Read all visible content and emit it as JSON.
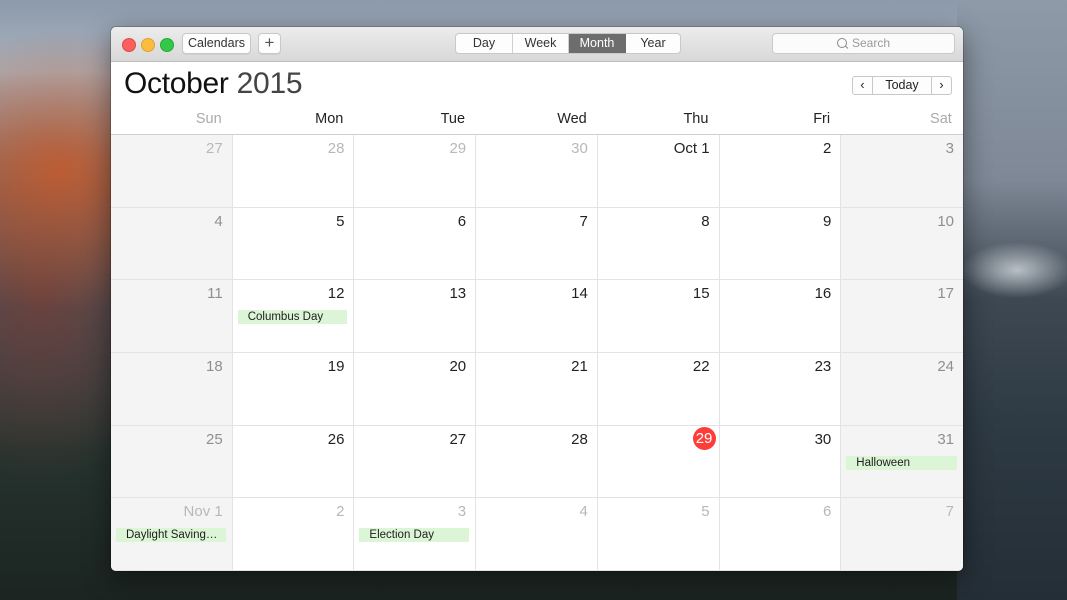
{
  "window": {
    "toolbar": {
      "calendars_label": "Calendars",
      "add_label": "+",
      "views": [
        {
          "label": "Day",
          "active": false
        },
        {
          "label": "Week",
          "active": false
        },
        {
          "label": "Month",
          "active": true
        },
        {
          "label": "Year",
          "active": false
        }
      ],
      "search_placeholder": "Search"
    },
    "header": {
      "month": "October",
      "year": "2015",
      "prev_label": "‹",
      "today_label": "Today",
      "next_label": "›"
    },
    "weekdays": [
      "Sun",
      "Mon",
      "Tue",
      "Wed",
      "Thu",
      "Fri",
      "Sat"
    ],
    "weeks": [
      [
        {
          "label": "27",
          "other": true
        },
        {
          "label": "28",
          "other": true
        },
        {
          "label": "29",
          "other": true
        },
        {
          "label": "30",
          "other": true
        },
        {
          "label": "Oct 1"
        },
        {
          "label": "2"
        },
        {
          "label": "3"
        }
      ],
      [
        {
          "label": "4"
        },
        {
          "label": "5"
        },
        {
          "label": "6"
        },
        {
          "label": "7"
        },
        {
          "label": "8"
        },
        {
          "label": "9"
        },
        {
          "label": "10"
        }
      ],
      [
        {
          "label": "11"
        },
        {
          "label": "12",
          "event": "Columbus Day"
        },
        {
          "label": "13"
        },
        {
          "label": "14"
        },
        {
          "label": "15"
        },
        {
          "label": "16"
        },
        {
          "label": "17"
        }
      ],
      [
        {
          "label": "18"
        },
        {
          "label": "19"
        },
        {
          "label": "20"
        },
        {
          "label": "21"
        },
        {
          "label": "22"
        },
        {
          "label": "23"
        },
        {
          "label": "24"
        }
      ],
      [
        {
          "label": "25"
        },
        {
          "label": "26"
        },
        {
          "label": "27"
        },
        {
          "label": "28"
        },
        {
          "label": "29",
          "today": true
        },
        {
          "label": "30"
        },
        {
          "label": "31",
          "event": "Halloween"
        }
      ],
      [
        {
          "label": "Nov 1",
          "other": true,
          "event": "Daylight Saving…"
        },
        {
          "label": "2",
          "other": true
        },
        {
          "label": "3",
          "other": true,
          "event": "Election Day"
        },
        {
          "label": "4",
          "other": true
        },
        {
          "label": "5",
          "other": true
        },
        {
          "label": "6",
          "other": true
        },
        {
          "label": "7",
          "other": true
        }
      ]
    ],
    "colors": {
      "today_badge": "#fc3d39",
      "event_fill": "#dcf5d6",
      "active_view": "#6d6d6d"
    }
  }
}
